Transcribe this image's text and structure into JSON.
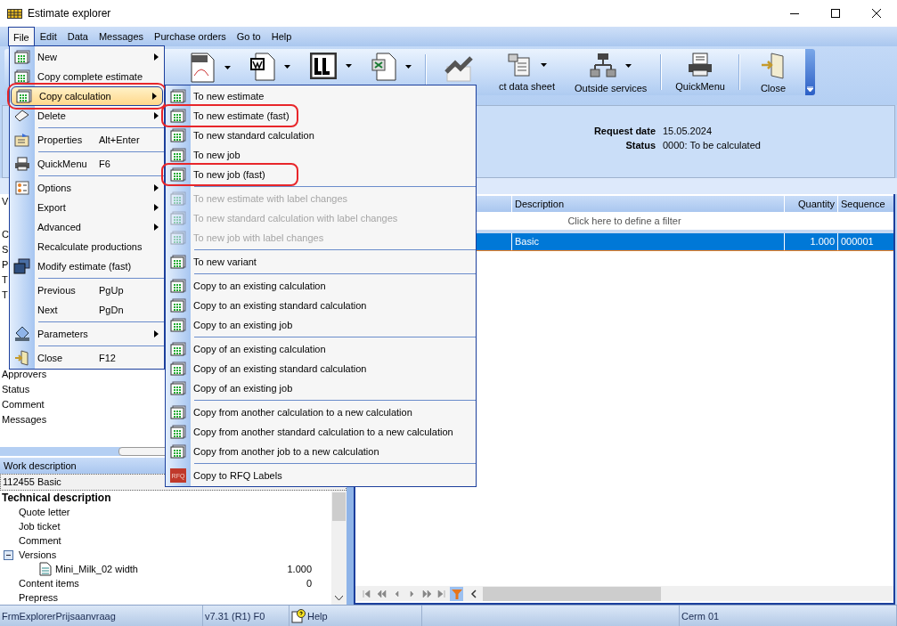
{
  "window": {
    "title": "Estimate explorer"
  },
  "menubar": [
    {
      "label": "File",
      "selected": true
    },
    {
      "label": "Edit",
      "selected": false
    },
    {
      "label": "Data",
      "selected": false
    },
    {
      "label": "Messages",
      "selected": false
    },
    {
      "label": "Purchase orders",
      "selected": false
    },
    {
      "label": "Go to",
      "selected": false
    },
    {
      "label": "Help",
      "selected": false
    }
  ],
  "toolbar": [
    {
      "kind": "pdf",
      "dropdown": true
    },
    {
      "kind": "word",
      "dropdown": true
    },
    {
      "kind": "ll",
      "dropdown": true
    },
    {
      "kind": "excel",
      "dropdown": true
    },
    {
      "kind": "separator"
    },
    {
      "kind": "chart",
      "dropdown": false
    },
    {
      "kind": "sheet",
      "label": "ct data sheet",
      "dropdown": true
    },
    {
      "kind": "network",
      "label": "Outside services",
      "dropdown": true
    },
    {
      "kind": "separator"
    },
    {
      "kind": "printer",
      "label": "QuickMenu",
      "dropdown": false
    },
    {
      "kind": "separator"
    },
    {
      "kind": "door",
      "label": "Close",
      "dropdown": false
    }
  ],
  "header": {
    "fields": [
      {
        "label": "Request date",
        "value": "15.05.2024"
      },
      {
        "label": "Status",
        "value": "0000: To be calculated"
      }
    ]
  },
  "properties": {
    "header": "V",
    "top": [
      "C",
      "S",
      "P",
      "T",
      "T"
    ],
    "bottom": [
      "Approvers",
      "Status",
      "Comment",
      "Messages"
    ]
  },
  "work_description": {
    "title": "Work description",
    "value": "112455 Basic",
    "tree": [
      {
        "label": "Technical description",
        "children": [
          {
            "label": "Quote letter"
          },
          {
            "label": "Job ticket"
          },
          {
            "label": "Comment"
          },
          {
            "label": "Versions",
            "expanded": true,
            "children": [
              {
                "kind": "document",
                "label": "Mini_Milk_02 width",
                "value": "1.000"
              }
            ]
          },
          {
            "label": "Content items",
            "value": "0"
          },
          {
            "label": "Prepress"
          }
        ]
      }
    ]
  },
  "grid": {
    "columns": [
      "Description",
      "Quantity",
      "Sequence"
    ],
    "filter_hint": "Click here to define a filter",
    "rows": [
      {
        "cells": [
          "Basic",
          "1.000",
          "000001"
        ],
        "selected": true
      }
    ]
  },
  "status_bar": [
    {
      "kind": "text",
      "text": "FrmExplorerPrijsaanvraag"
    },
    {
      "kind": "text",
      "text": "v7.31 (R1) F0"
    },
    {
      "kind": "help",
      "text": "Help"
    },
    {
      "kind": "empty"
    },
    {
      "kind": "text",
      "text": "Cerm 01"
    }
  ],
  "file_menu": {
    "items": [
      {
        "kind": "calc",
        "label": "New",
        "submenu": true,
        "selected": false,
        "highlighted": false
      },
      {
        "kind": "calc",
        "label": "Copy complete estimate",
        "submenu": false,
        "selected": false,
        "highlighted": false
      },
      {
        "kind": "calc",
        "label": "Copy calculation",
        "submenu": true,
        "selected": true,
        "highlighted": true
      },
      {
        "kind": "eraser",
        "label": "Delete",
        "submenu": true,
        "selected": false,
        "highlighted": false
      },
      {
        "kind": "separator"
      },
      {
        "kind": "properties",
        "label": "Properties",
        "shortcut": "Alt+Enter",
        "submenu": false,
        "selected": false,
        "highlighted": false
      },
      {
        "kind": "separator"
      },
      {
        "kind": "printer",
        "label": "QuickMenu",
        "shortcut": "F6",
        "submenu": false,
        "selected": false,
        "highlighted": false
      },
      {
        "kind": "separator"
      },
      {
        "kind": "options",
        "label": "Options",
        "submenu": true,
        "selected": false,
        "highlighted": false
      },
      {
        "kind": "plain",
        "label": "Export",
        "submenu": true,
        "selected": false,
        "highlighted": false
      },
      {
        "kind": "plain",
        "label": "Advanced",
        "submenu": true,
        "selected": false,
        "highlighted": false
      },
      {
        "kind": "plain",
        "label": "Recalculate productions",
        "submenu": false,
        "selected": false,
        "highlighted": false
      },
      {
        "kind": "windows",
        "label": "Modify estimate (fast)",
        "submenu": false,
        "selected": false,
        "highlighted": false
      },
      {
        "kind": "separator"
      },
      {
        "kind": "plain",
        "label": "Previous",
        "shortcut": "PgUp",
        "submenu": false,
        "selected": false,
        "highlighted": false
      },
      {
        "kind": "plain",
        "label": "Next",
        "shortcut": "PgDn",
        "submenu": false,
        "selected": false,
        "highlighted": false
      },
      {
        "kind": "separator"
      },
      {
        "kind": "parameters",
        "label": "Parameters",
        "submenu": true,
        "selected": false,
        "highlighted": false
      },
      {
        "kind": "separator"
      },
      {
        "kind": "door",
        "label": "Close",
        "shortcut": "F12",
        "submenu": false,
        "selected": false,
        "highlighted": false
      }
    ]
  },
  "submenu": {
    "items": [
      {
        "kind": "calc",
        "label": "To new estimate",
        "disabled": false,
        "highlighted": false
      },
      {
        "kind": "calc",
        "label": "To new estimate (fast)",
        "disabled": false,
        "highlighted": true
      },
      {
        "kind": "calc",
        "label": "To new standard calculation",
        "disabled": false,
        "highlighted": false
      },
      {
        "kind": "calc",
        "label": "To new job",
        "disabled": false,
        "highlighted": false
      },
      {
        "kind": "calc",
        "label": "To new job (fast)",
        "disabled": false,
        "highlighted": true
      },
      {
        "kind": "separator"
      },
      {
        "kind": "calc",
        "label": "To new estimate with label changes",
        "disabled": true,
        "highlighted": false
      },
      {
        "kind": "calc",
        "label": "To new standard calculation with label changes",
        "disabled": true,
        "highlighted": false
      },
      {
        "kind": "calc",
        "label": "To new job with label changes",
        "disabled": true,
        "highlighted": false
      },
      {
        "kind": "separator"
      },
      {
        "kind": "calc",
        "label": "To new variant",
        "disabled": false,
        "highlighted": false
      },
      {
        "kind": "separator"
      },
      {
        "kind": "calc",
        "label": "Copy to an existing calculation",
        "disabled": false,
        "highlighted": false
      },
      {
        "kind": "calc",
        "label": "Copy to an existing standard calculation",
        "disabled": false,
        "highlighted": false
      },
      {
        "kind": "calc",
        "label": "Copy to an existing job",
        "disabled": false,
        "highlighted": false
      },
      {
        "kind": "separator"
      },
      {
        "kind": "calc",
        "label": "Copy of an existing calculation",
        "disabled": false,
        "highlighted": false
      },
      {
        "kind": "calc",
        "label": "Copy of an existing standard calculation",
        "disabled": false,
        "highlighted": false
      },
      {
        "kind": "calc",
        "label": "Copy of an existing job",
        "disabled": false,
        "highlighted": false
      },
      {
        "kind": "separator"
      },
      {
        "kind": "calc",
        "label": "Copy from another calculation to a new calculation",
        "disabled": false,
        "highlighted": false
      },
      {
        "kind": "calc",
        "label": "Copy from another standard calculation to a new calculation",
        "disabled": false,
        "highlighted": false
      },
      {
        "kind": "calc",
        "label": "Copy from another job to a new calculation",
        "disabled": false,
        "highlighted": false
      },
      {
        "kind": "separator"
      },
      {
        "kind": "rfq",
        "label": "Copy to RFQ Labels",
        "badge": "RFQ",
        "disabled": false,
        "highlighted": false
      }
    ]
  }
}
